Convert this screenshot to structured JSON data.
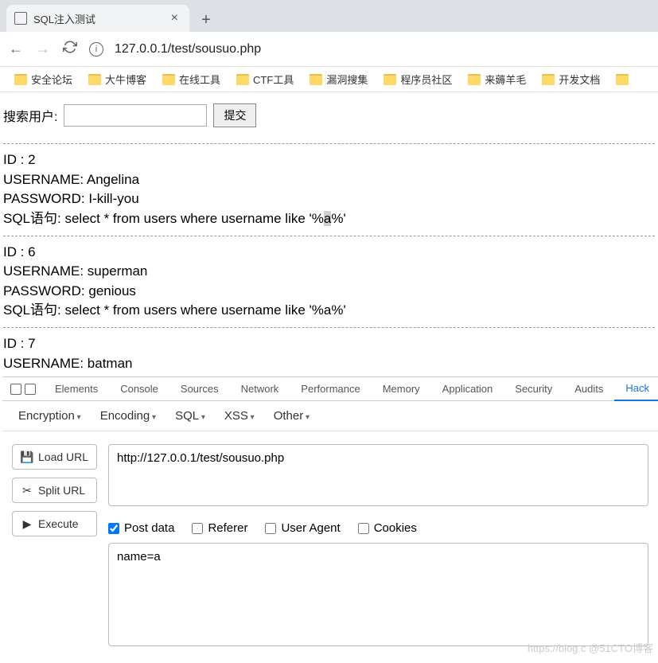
{
  "tab": {
    "title": "SQL注入测试"
  },
  "url": "127.0.0.1/test/sousuo.php",
  "bookmarks": [
    "安全论坛",
    "大牛博客",
    "在线工具",
    "CTF工具",
    "漏洞搜集",
    "程序员社区",
    "来薅羊毛",
    "开发文档"
  ],
  "page": {
    "search_label": "搜索用户:",
    "submit_label": "提交",
    "records": [
      {
        "id_label": "ID : 2",
        "user_label": "USERNAME: Angelina",
        "pass_label": "PASSWORD: I-kill-you",
        "sql_prefix": "SQL语句: select * from users where username like '%",
        "sql_hl": "a",
        "sql_suffix": "%'"
      },
      {
        "id_label": "ID : 6",
        "user_label": "USERNAME: superman",
        "pass_label": "PASSWORD: genious",
        "sql_label": "SQL语句: select * from users where username like '%a%'"
      },
      {
        "id_label": "ID : 7",
        "user_label": "USERNAME: batman"
      }
    ]
  },
  "devtools": {
    "tabs": [
      "Elements",
      "Console",
      "Sources",
      "Network",
      "Performance",
      "Memory",
      "Application",
      "Security",
      "Audits",
      "Hack"
    ],
    "active_tab": "Hack"
  },
  "hackbar": {
    "menus": [
      "Encryption",
      "Encoding",
      "SQL",
      "XSS",
      "Other"
    ],
    "buttons": {
      "load": "Load URL",
      "split": "Split URL",
      "execute": "Execute"
    },
    "url_value": "http://127.0.0.1/test/sousuo.php",
    "checks": {
      "post": "Post data",
      "referer": "Referer",
      "ua": "User Agent",
      "cookies": "Cookies"
    },
    "post_value": "name=a"
  },
  "watermark": "https://blog.c  @51CTO博客"
}
